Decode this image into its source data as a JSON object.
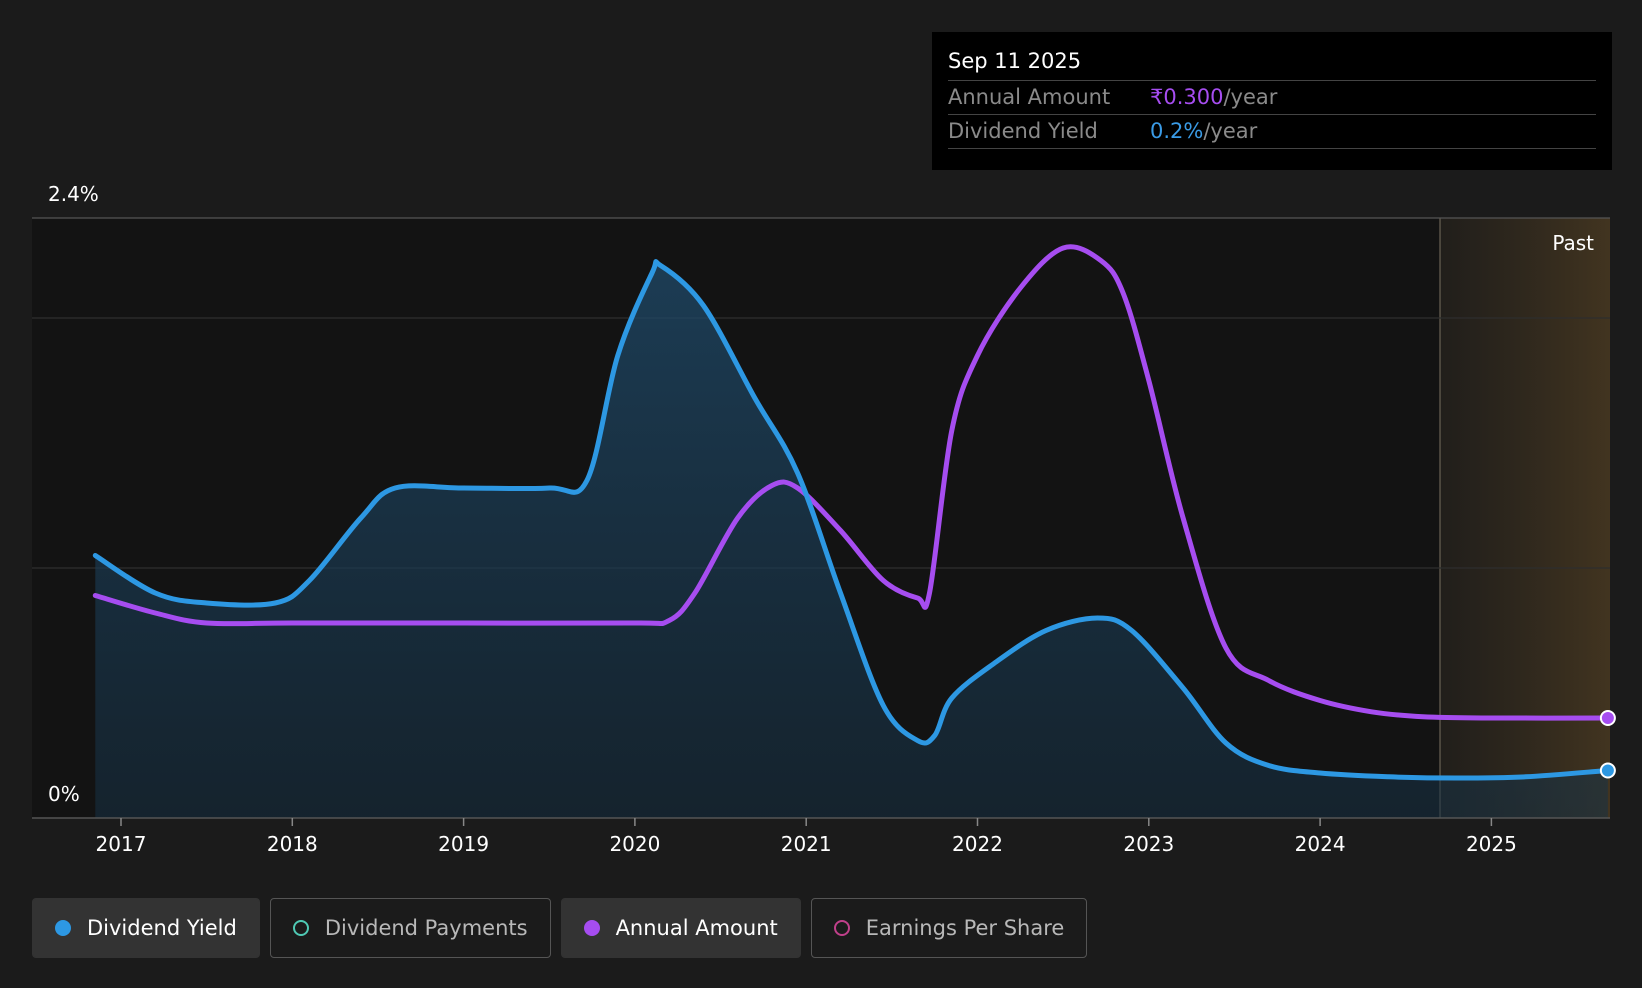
{
  "colors": {
    "dividend_yield": "#2d98e3",
    "annual_amount": "#a64df0",
    "dividend_payments": "#4fc9b4",
    "earnings_per_share": "#c0408a",
    "background": "#1b1b1b"
  },
  "tooltip": {
    "date": "Sep 11 2025",
    "rows": [
      {
        "label": "Annual Amount",
        "value": "₹0.300",
        "unit": "/year"
      },
      {
        "label": "Dividend Yield",
        "value": "0.2%",
        "unit": "/year"
      }
    ]
  },
  "legend": [
    {
      "label": "Dividend Yield",
      "active": true,
      "icon": "filled-dot-icon"
    },
    {
      "label": "Dividend Payments",
      "active": false,
      "icon": "hollow-dot-icon"
    },
    {
      "label": "Annual Amount",
      "active": true,
      "icon": "filled-dot-icon"
    },
    {
      "label": "Earnings Per Share",
      "active": false,
      "icon": "hollow-dot-icon"
    }
  ],
  "chart_data": {
    "type": "line",
    "title": "",
    "xlabel": "",
    "ylabel": "",
    "y_top_label": "2.4%",
    "y_bottom_label": "0%",
    "ylim": [
      0,
      2.4
    ],
    "xlim": [
      2016.5,
      2025.7
    ],
    "x_ticks": [
      "2017",
      "2018",
      "2019",
      "2020",
      "2021",
      "2022",
      "2023",
      "2024",
      "2025"
    ],
    "past_label": "Past",
    "past_region_start": 2024.7,
    "gridlines": [
      1.0,
      2.0,
      2.4
    ],
    "series": [
      {
        "name": "Dividend Yield",
        "area": true,
        "points": [
          [
            2016.85,
            1.05
          ],
          [
            2017.2,
            0.9
          ],
          [
            2017.5,
            0.86
          ],
          [
            2017.9,
            0.86
          ],
          [
            2018.1,
            0.95
          ],
          [
            2018.4,
            1.2
          ],
          [
            2018.6,
            1.32
          ],
          [
            2019.0,
            1.32
          ],
          [
            2019.5,
            1.32
          ],
          [
            2019.72,
            1.35
          ],
          [
            2019.9,
            1.85
          ],
          [
            2020.1,
            2.18
          ],
          [
            2020.15,
            2.21
          ],
          [
            2020.4,
            2.05
          ],
          [
            2020.7,
            1.68
          ],
          [
            2020.95,
            1.38
          ],
          [
            2021.2,
            0.9
          ],
          [
            2021.45,
            0.45
          ],
          [
            2021.65,
            0.31
          ],
          [
            2021.75,
            0.33
          ],
          [
            2021.85,
            0.48
          ],
          [
            2022.1,
            0.62
          ],
          [
            2022.4,
            0.75
          ],
          [
            2022.7,
            0.8
          ],
          [
            2022.9,
            0.75
          ],
          [
            2023.2,
            0.52
          ],
          [
            2023.45,
            0.3
          ],
          [
            2023.7,
            0.21
          ],
          [
            2024.0,
            0.18
          ],
          [
            2024.4,
            0.165
          ],
          [
            2024.8,
            0.16
          ],
          [
            2025.2,
            0.165
          ],
          [
            2025.68,
            0.19
          ]
        ]
      },
      {
        "name": "Annual Amount",
        "area": false,
        "points": [
          [
            2016.85,
            0.89
          ],
          [
            2017.2,
            0.82
          ],
          [
            2017.5,
            0.78
          ],
          [
            2018.0,
            0.78
          ],
          [
            2019.0,
            0.78
          ],
          [
            2020.0,
            0.78
          ],
          [
            2020.2,
            0.79
          ],
          [
            2020.35,
            0.9
          ],
          [
            2020.6,
            1.2
          ],
          [
            2020.8,
            1.33
          ],
          [
            2020.95,
            1.32
          ],
          [
            2021.2,
            1.15
          ],
          [
            2021.45,
            0.95
          ],
          [
            2021.65,
            0.88
          ],
          [
            2021.72,
            0.9
          ],
          [
            2021.85,
            1.55
          ],
          [
            2022.0,
            1.85
          ],
          [
            2022.25,
            2.12
          ],
          [
            2022.5,
            2.28
          ],
          [
            2022.72,
            2.23
          ],
          [
            2022.85,
            2.1
          ],
          [
            2023.0,
            1.75
          ],
          [
            2023.2,
            1.2
          ],
          [
            2023.45,
            0.68
          ],
          [
            2023.7,
            0.55
          ],
          [
            2024.0,
            0.47
          ],
          [
            2024.3,
            0.425
          ],
          [
            2024.6,
            0.405
          ],
          [
            2025.0,
            0.4
          ],
          [
            2025.68,
            0.4
          ]
        ]
      }
    ]
  }
}
